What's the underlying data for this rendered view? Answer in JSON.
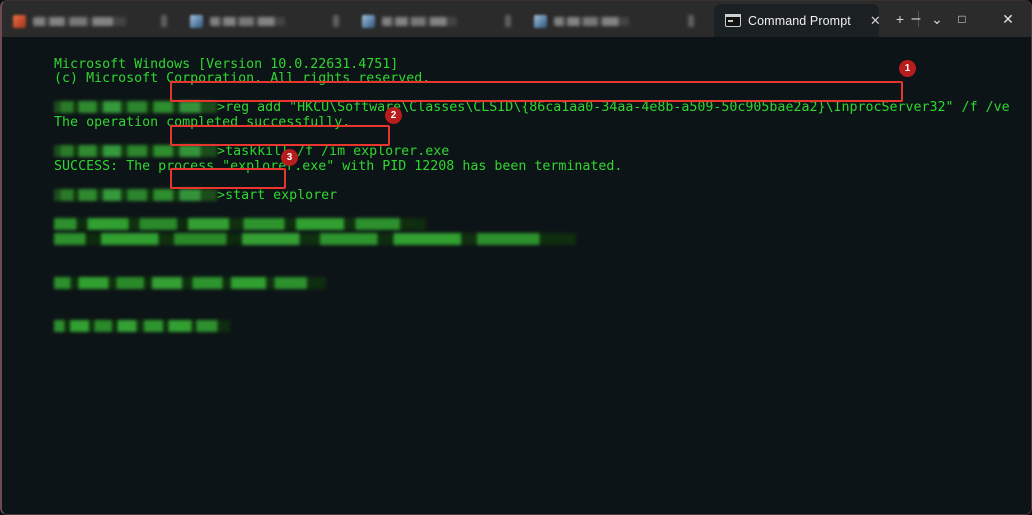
{
  "window": {
    "title": "Command Prompt",
    "accent_red": "#e8352e",
    "badge_red": "#b81d1d",
    "terminal_bg": "#0d1417",
    "terminal_fg": "#2fd62f",
    "titlebar_bg": "#2b2b2b"
  },
  "tabs": [
    {
      "id": "tab-1",
      "label": "",
      "redacted": true,
      "icon": "app-icon-orange",
      "active": false
    },
    {
      "id": "tab-2",
      "label": "",
      "redacted": true,
      "icon": "app-icon-blue",
      "active": false
    },
    {
      "id": "tab-3",
      "label": "",
      "redacted": true,
      "icon": "app-icon-blue",
      "active": false
    },
    {
      "id": "tab-4",
      "label": "",
      "redacted": true,
      "icon": "app-icon-blue",
      "active": false
    },
    {
      "id": "tab-active",
      "label": "Command Prompt",
      "redacted": false,
      "icon": "terminal-icon",
      "active": true
    }
  ],
  "tab_actions": {
    "new_tab": "+",
    "dropdown": "⌄",
    "close_tab": "✕"
  },
  "window_controls": {
    "minimize": "–",
    "maximize": "□",
    "close": "✕"
  },
  "terminal": {
    "lines": [
      {
        "type": "text",
        "text": "Microsoft Windows [Version 10.0.22631.4751]"
      },
      {
        "type": "text",
        "text": "(c) Microsoft Corporation. All rights reserved."
      },
      {
        "type": "blank",
        "text": ""
      },
      {
        "type": "command",
        "prompt_redacted": true,
        "text": "reg add \"HKCU\\Software\\Classes\\CLSID\\{86ca1aa0-34aa-4e8b-a509-50c905bae2a2}\\InprocServer32\" /f /ve"
      },
      {
        "type": "text",
        "text": "The operation completed successfully."
      },
      {
        "type": "blank",
        "text": ""
      },
      {
        "type": "command",
        "prompt_redacted": true,
        "text": "taskkill /f /im explorer.exe"
      },
      {
        "type": "text",
        "text": "SUCCESS: The process \"explorer.exe\" with PID 12208 has been terminated."
      },
      {
        "type": "blank",
        "text": ""
      },
      {
        "type": "command",
        "prompt_redacted": true,
        "text": "start explorer"
      },
      {
        "type": "blank",
        "text": ""
      },
      {
        "type": "redacted",
        "text": ""
      },
      {
        "type": "redacted",
        "text": ""
      },
      {
        "type": "blank",
        "text": ""
      },
      {
        "type": "redacted",
        "text": ""
      },
      {
        "type": "blank",
        "text": ""
      },
      {
        "type": "redacted",
        "text": ""
      }
    ]
  },
  "annotations": [
    {
      "number": "1",
      "target": "reg-add-command"
    },
    {
      "number": "2",
      "target": "taskkill-command"
    },
    {
      "number": "3",
      "target": "start-explorer-command"
    }
  ]
}
